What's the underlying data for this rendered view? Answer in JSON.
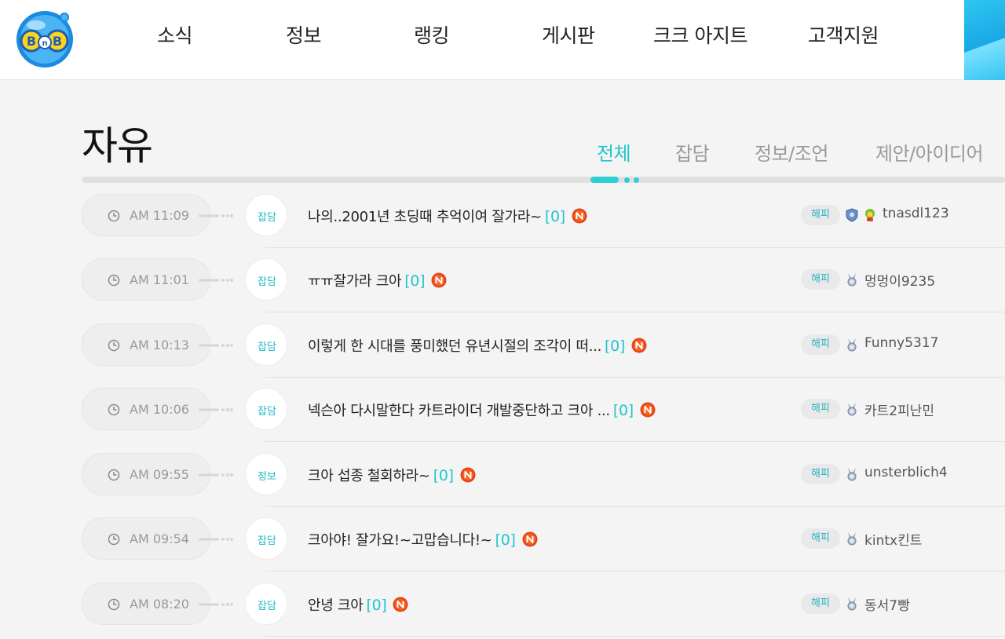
{
  "header": {
    "logo_text": "BnB",
    "nav": [
      "소식",
      "정보",
      "랭킹",
      "게시판",
      "크크 아지트",
      "고객지원"
    ]
  },
  "board": {
    "title": "자유",
    "tabs": [
      "전체",
      "잡담",
      "정보/조언",
      "제안/아이디어"
    ],
    "active_tab": "전체"
  },
  "posts": [
    {
      "time": "AM 11:09",
      "category": "잡담",
      "title": "나의..2001년 초딩때 추억이여 잘가라~",
      "comments": "[0]",
      "server": "해피",
      "author": "tnasdl123",
      "icons": [
        "shield-badge-icon",
        "character-avatar-icon"
      ]
    },
    {
      "time": "AM 11:01",
      "category": "잡담",
      "title": "ㅠㅠ잘가라 크아",
      "comments": "[0]",
      "server": "해피",
      "author": "멍멍이9235",
      "icons": [
        "rank-medal-icon"
      ]
    },
    {
      "time": "AM 10:13",
      "category": "잡담",
      "title": "이렇게 한 시대를 풍미했던 유년시절의 조각이 떠...",
      "comments": "[0]",
      "server": "해피",
      "author": "Funny5317",
      "icons": [
        "rank-medal-icon"
      ]
    },
    {
      "time": "AM 10:06",
      "category": "잡담",
      "title": "넥슨아 다시말한다 카트라이더 개발중단하고 크아 ...",
      "comments": "[0]",
      "server": "해피",
      "author": "카트2피난민",
      "icons": [
        "rank-medal-icon"
      ]
    },
    {
      "time": "AM 09:55",
      "category": "정보",
      "title": "크아 섭종 철회하라~",
      "comments": "[0]",
      "server": "해피",
      "author": "unsterblich4",
      "icons": [
        "rank-medal-icon"
      ]
    },
    {
      "time": "AM 09:54",
      "category": "잡담",
      "title": "크아야! 잘가요!~고맙습니다!~",
      "comments": "[0]",
      "server": "해피",
      "author": "kintx킨트",
      "icons": [
        "rank-medal-icon"
      ]
    },
    {
      "time": "AM 08:20",
      "category": "잡담",
      "title": "안녕 크아",
      "comments": "[0]",
      "server": "해피",
      "author": "동서7빵",
      "icons": [
        "rank-medal-icon"
      ]
    }
  ],
  "colors": {
    "accent": "#22c5cc",
    "new_badge": "#e8431c",
    "logo_blue": "#1a8be0",
    "logo_yellow": "#ffd21e"
  }
}
